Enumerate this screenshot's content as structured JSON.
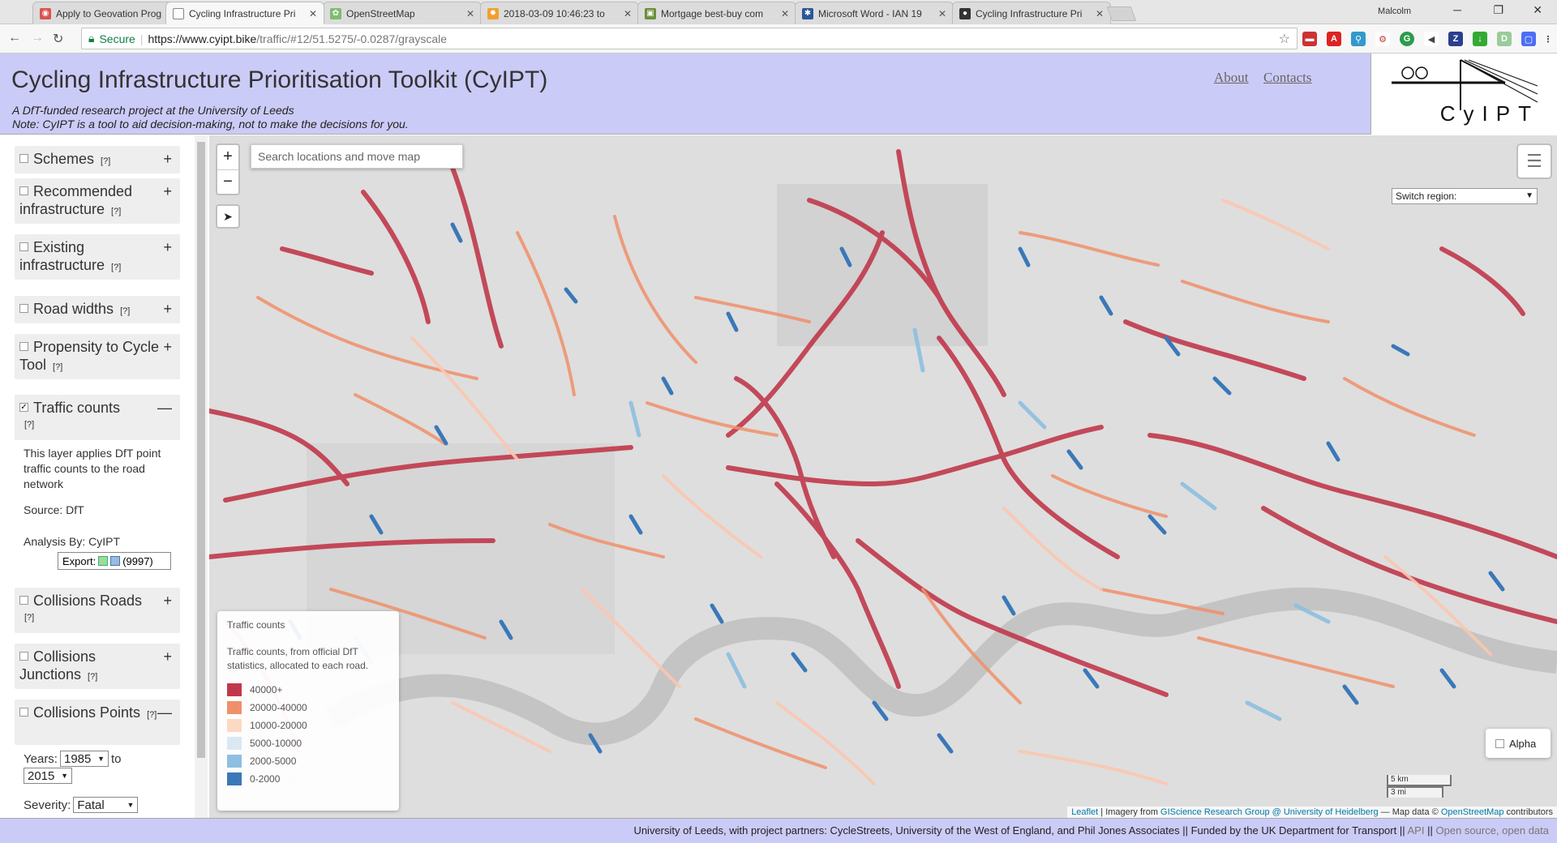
{
  "browser": {
    "tabs": [
      {
        "title": "Apply to Geovation Prog",
        "favicon_color": "#d9534f"
      },
      {
        "title": "Cycling Infrastructure Pri",
        "favicon_color": "#888888"
      },
      {
        "title": "OpenStreetMap",
        "favicon_color": "#7ebc6f"
      },
      {
        "title": "2018-03-09 10:46:23 to",
        "favicon_color": "#f0a030"
      },
      {
        "title": "Mortgage best-buy com",
        "favicon_color": "#6a8f3a"
      },
      {
        "title": "Microsoft Word - IAN 19",
        "favicon_color": "#2b5797"
      },
      {
        "title": "Cycling Infrastructure Pri",
        "favicon_color": "#333333"
      }
    ],
    "user_name": "Malcolm",
    "secure_label": "Secure",
    "url_host": "https://www.cyipt.bike",
    "url_path": "/traffic/#12/51.5275/-0.0287/grayscale"
  },
  "header": {
    "title": "Cycling Infrastructure Prioritisation Toolkit (CyIPT)",
    "subtitle_line1": "A DfT-funded research project at the University of Leeds",
    "subtitle_line2": "Note: CyIPT is a tool to aid decision-making, not to make the decisions for you.",
    "about": "About",
    "contacts": "Contacts",
    "logo_text": "CyIPT"
  },
  "sidebar": {
    "help": "[?]",
    "layers": [
      {
        "label": "Schemes",
        "checked": false,
        "toggle": "+"
      },
      {
        "label": "Recommended infrastructure",
        "checked": false,
        "toggle": "+"
      },
      {
        "label": "Existing infrastructure",
        "checked": false,
        "toggle": "+"
      },
      {
        "label": "Road widths",
        "checked": false,
        "toggle": "+"
      },
      {
        "label": "Propensity to Cycle Tool",
        "checked": false,
        "toggle": "+"
      },
      {
        "label": "Traffic counts",
        "checked": true,
        "toggle": "—"
      },
      {
        "label": "Collisions Roads",
        "checked": false,
        "toggle": "+"
      },
      {
        "label": "Collisions Junctions",
        "checked": false,
        "toggle": "+"
      },
      {
        "label": "Collisions Points",
        "checked": false,
        "toggle": "—"
      }
    ],
    "traffic_desc": "This layer applies DfT point traffic counts to the road network",
    "source": "Source: DfT",
    "analysis": "Analysis By: CyIPT",
    "export_label": "Export:",
    "export_count": "(9997)",
    "years_label": "Years:",
    "year_from": "1985",
    "to_label": "to",
    "year_to": "2015",
    "severity_label": "Severity:",
    "severity_value": "Fatal"
  },
  "map": {
    "search_placeholder": "Search locations and move map",
    "zoom_in": "+",
    "zoom_out": "−",
    "switch_region": "Switch region:",
    "alpha_label": "Alpha",
    "scale_km": "5 km",
    "scale_mi": "3 mi",
    "attribution_leaflet": "Leaflet",
    "attribution_imagery": " | Imagery from ",
    "attribution_giscience": "GIScience Research Group @ University of Heidelberg",
    "attribution_mapdata": " — Map data © ",
    "attribution_osm": "OpenStreetMap",
    "attribution_contrib": " contributors",
    "legend": {
      "title": "Traffic counts",
      "description": "Traffic counts, from official DfT statistics, allocated to each road.",
      "items": [
        {
          "label": "40000+",
          "color": "#c0394b"
        },
        {
          "label": "20000-40000",
          "color": "#f0906a"
        },
        {
          "label": "10000-20000",
          "color": "#fcd9c5"
        },
        {
          "label": "5000-10000",
          "color": "#dbe8f2"
        },
        {
          "label": "2000-5000",
          "color": "#8dbfe0"
        },
        {
          "label": "0-2000",
          "color": "#3a78b8"
        }
      ]
    }
  },
  "footer": {
    "text": "University of Leeds, with project partners: CycleStreets, University of the West of England, and Phil Jones Associates  ||  Funded by the UK Department for Transport  ||",
    "api": "API",
    "sep": "||",
    "open_source": "Open source, open data"
  }
}
